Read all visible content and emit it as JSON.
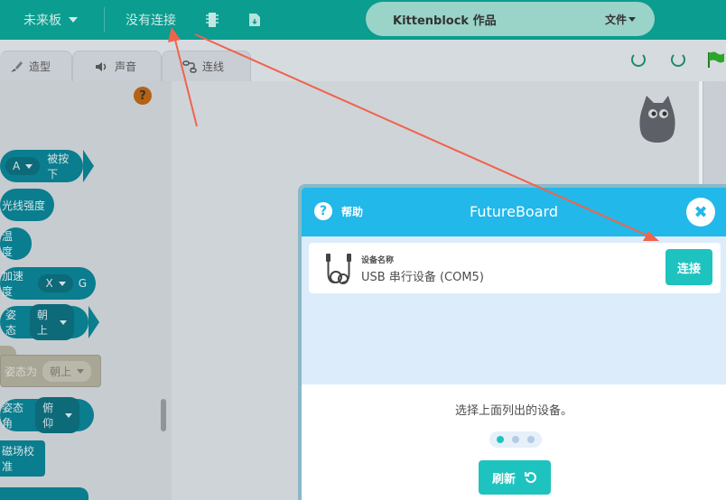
{
  "menubar": {
    "board_label": "未来板",
    "connection_label": "没有连接",
    "project_title": "Kittenblock 作品",
    "file_menu": "文件"
  },
  "tabs": {
    "costumes": "造型",
    "sounds": "声音",
    "connect": "连线"
  },
  "palette": {
    "blocks": [
      {
        "text_a": "A",
        "text_b": "被按下"
      },
      {
        "text": "光线强度"
      },
      {
        "text": "温度"
      },
      {
        "text": "加速度",
        "pill": "X",
        "suffix": "G"
      },
      {
        "text": "姿态",
        "pill": "朝上"
      },
      {
        "text": "姿态为",
        "pill": "朝上"
      },
      {
        "text": "姿态角",
        "pill": "俯仰"
      },
      {
        "text": "磁场校准"
      }
    ]
  },
  "modal": {
    "help_label": "帮助",
    "title": "FutureBoard",
    "device_label": "设备名称",
    "device_name": "USB 串行设备 (COM5)",
    "connect_button": "连接",
    "hint": "选择上面列出的设备。",
    "refresh_button": "刷新",
    "step_dots": 3,
    "active_dot": 1
  },
  "colors": {
    "menubar": "#0b9d8f",
    "modal_header": "#22b8e9",
    "accent_button": "#1ec3c0",
    "arrow": "#f0644c"
  },
  "icons": [
    "chevron-down-icon",
    "board-icon",
    "file-icon",
    "brush-icon",
    "speaker-icon",
    "link-icon",
    "undo-icon",
    "redo-icon",
    "green-flag-icon",
    "warning-icon",
    "help-icon",
    "close-icon",
    "usb-cable-icon",
    "refresh-icon",
    "cat-sprite-icon"
  ]
}
